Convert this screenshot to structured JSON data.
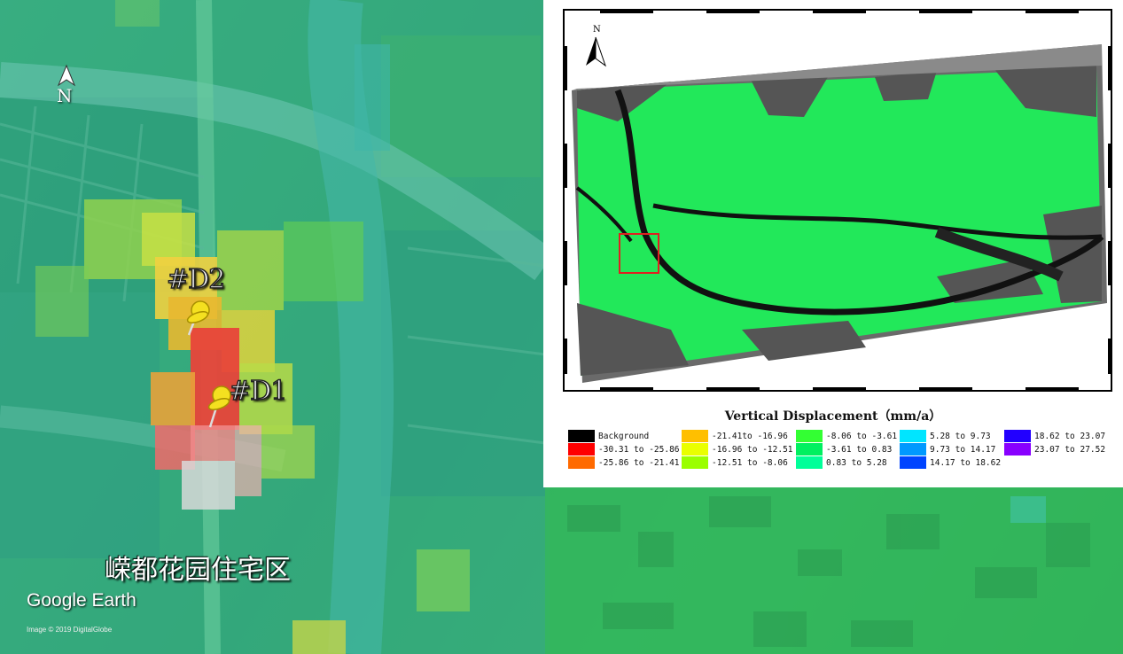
{
  "main_map": {
    "north_label": "N",
    "pins": [
      {
        "label": "#D2"
      },
      {
        "label": "#D1"
      }
    ],
    "place_label": "嵘都花园住宅区",
    "logo_text": "Google Earth",
    "credit_text": "Image © 2019 DigitalGlobe"
  },
  "inset_map": {
    "north_label": "N",
    "legend_title": "Vertical Displacement（mm/a）",
    "legend": [
      {
        "label": "Background",
        "color": "#000000"
      },
      {
        "label": "-30.31 to -25.86",
        "color": "#ff0000"
      },
      {
        "label": "-25.86 to -21.41",
        "color": "#ff6a00"
      },
      {
        "label": "-21.41to -16.96",
        "color": "#ffbf00"
      },
      {
        "label": "-16.96 to -12.51",
        "color": "#eaff00"
      },
      {
        "label": "-12.51 to -8.06",
        "color": "#9bff00"
      },
      {
        "label": "-8.06 to -3.61",
        "color": "#33ff33"
      },
      {
        "label": "-3.61 to 0.83",
        "color": "#00f060"
      },
      {
        "label": "0.83 to 5.28",
        "color": "#00ff99"
      },
      {
        "label": "5.28 to 9.73",
        "color": "#00e5ff"
      },
      {
        "label": "9.73 to 14.17",
        "color": "#0099ff"
      },
      {
        "label": "14.17 to 18.62",
        "color": "#0044ff"
      },
      {
        "label": "18.62 to 23.07",
        "color": "#2200ff"
      },
      {
        "label": "23.07 to 27.52",
        "color": "#8800ff"
      }
    ]
  }
}
